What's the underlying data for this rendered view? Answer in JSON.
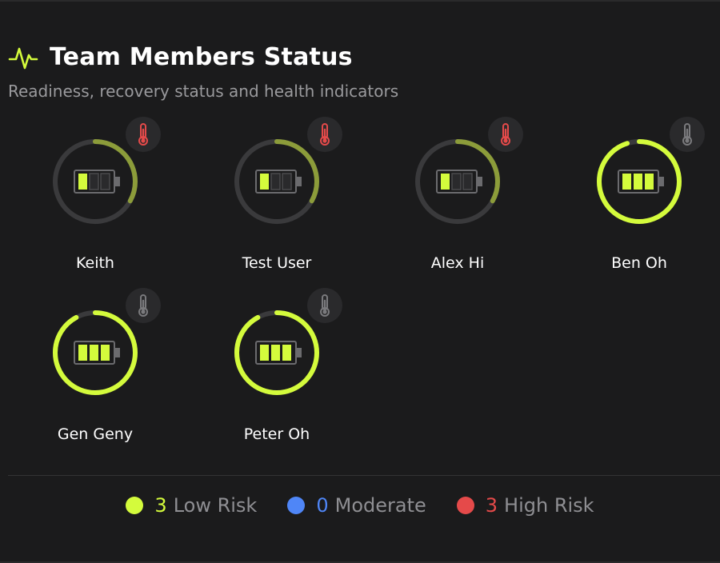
{
  "header": {
    "title": "Team Members Status",
    "subtitle": "Readiness, recovery status and health indicators",
    "icon": "pulse-icon"
  },
  "colors": {
    "low": "#d4fb3c",
    "low_dim": "#8c9c3a",
    "moderate": "#4f86f7",
    "high": "#e54a4a",
    "thermo_neutral": "#7a7a7d",
    "track": "#3a3a3c"
  },
  "members": [
    {
      "name": "Keith",
      "readiness": 0.33,
      "battery_bars": 1,
      "thermometer": "high"
    },
    {
      "name": "Test User",
      "readiness": 0.33,
      "battery_bars": 1,
      "thermometer": "high"
    },
    {
      "name": "Alex Hi",
      "readiness": 0.33,
      "battery_bars": 1,
      "thermometer": "high"
    },
    {
      "name": "Ben Oh",
      "readiness": 0.95,
      "battery_bars": 3,
      "thermometer": "neutral"
    },
    {
      "name": "Gen Geny",
      "readiness": 0.92,
      "battery_bars": 3,
      "thermometer": "neutral"
    },
    {
      "name": "Peter Oh",
      "readiness": 0.92,
      "battery_bars": 3,
      "thermometer": "neutral"
    }
  ],
  "legend": {
    "low": {
      "count": "3",
      "label": "Low Risk"
    },
    "moderate": {
      "count": "0",
      "label": "Moderate"
    },
    "high": {
      "count": "3",
      "label": "High Risk"
    }
  }
}
